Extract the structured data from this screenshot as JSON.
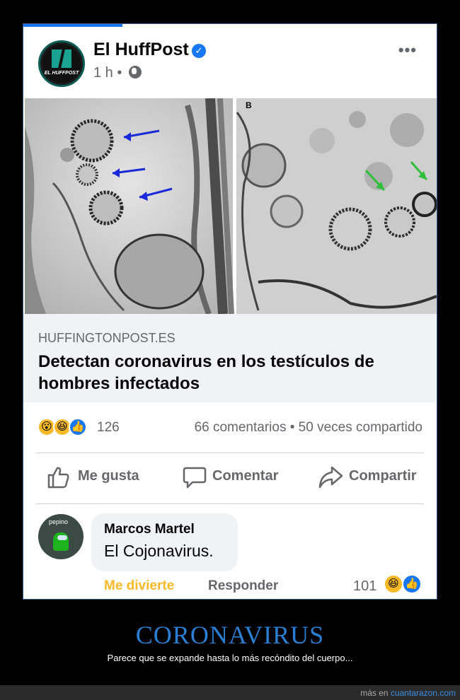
{
  "post": {
    "page_name": "El HuffPost",
    "logo_text": "EL HUFFPOST",
    "time": "1 h",
    "separator": "•",
    "more_icon": "more-horizontal-icon",
    "verified_icon": "verified-badge-icon",
    "globe_icon": "globe-icon",
    "image_label": "B"
  },
  "link": {
    "domain": "HUFFINGTONPOST.ES",
    "headline": "Detectan coronavirus en los testículos de hombres infectados"
  },
  "reactions": {
    "count": "126",
    "stats": "66 comentarios • 50 veces compartido",
    "icons": [
      "wow-reaction-icon",
      "haha-reaction-icon",
      "like-reaction-icon"
    ]
  },
  "actions": {
    "like": "Me gusta",
    "comment": "Comentar",
    "share": "Compartir"
  },
  "comment": {
    "avatar_tag": "pepino",
    "author": "Marcos Martel",
    "text": "El Cojonavirus.",
    "laugh_label": "Me divierte",
    "reply_label": "Responder",
    "reaction_count": "101"
  },
  "caption": {
    "title": "CORONAVIRUS",
    "subtitle": "Parece que se expande hasta lo más recóndito del cuerpo..."
  },
  "footer": {
    "prefix": "más en",
    "site": "cuantarazon.com"
  },
  "colors": {
    "facebook_blue": "#1877f2",
    "caption_blue": "#2a7fd4",
    "haha_yellow": "#f7b928",
    "arrow_blue": "#1a2ad8",
    "arrow_green": "#2fbf3a"
  }
}
